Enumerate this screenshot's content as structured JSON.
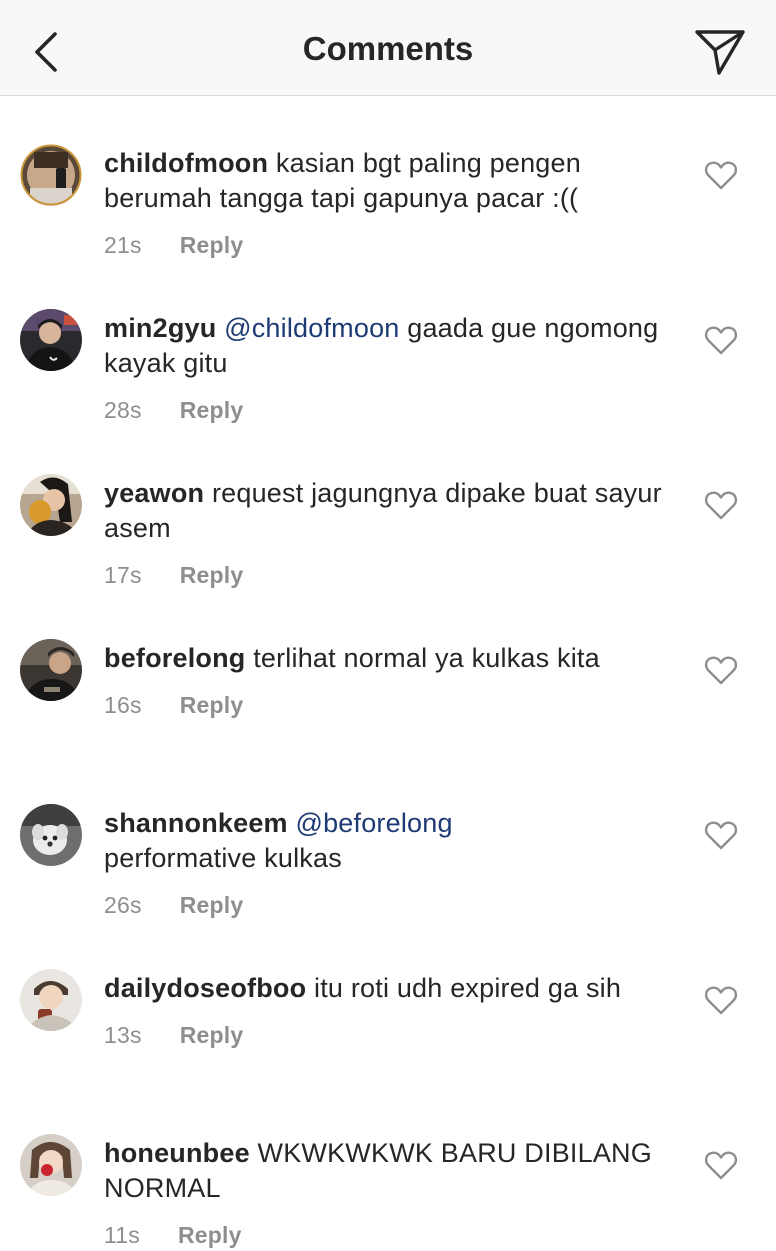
{
  "header": {
    "title": "Comments",
    "back_icon": "chevron-left-icon",
    "send_icon": "paper-plane-icon"
  },
  "reply_label": "Reply",
  "comments": [
    {
      "username": "childofmoon",
      "mention": "",
      "text": "kasian bgt paling pengen berumah tangga tapi gapunya pacar :((",
      "time": "21s"
    },
    {
      "username": "min2gyu",
      "mention": "@childofmoon",
      "text": "gaada gue ngomong kayak gitu",
      "time": "28s"
    },
    {
      "username": "yeawon",
      "mention": "",
      "text": "request jagungnya dipake buat sayur asem",
      "time": "17s"
    },
    {
      "username": "beforelong",
      "mention": "",
      "text": "terlihat normal ya kulkas kita",
      "time": "16s"
    },
    {
      "username": "shannonkeem",
      "mention": "@beforelong",
      "text": "performative kulkas",
      "time": "26s"
    },
    {
      "username": "dailydoseofboo",
      "mention": "",
      "text": "itu roti udh expired ga sih",
      "time": "13s"
    },
    {
      "username": "honeunbee",
      "mention": "",
      "text": "WKWKWKWK BARU DIBILANG NORMAL",
      "time": "11s"
    }
  ],
  "colors": {
    "mention": "#1f3b75",
    "secondary_text": "#8e8e8e",
    "header_bg": "#f8f8f8"
  }
}
